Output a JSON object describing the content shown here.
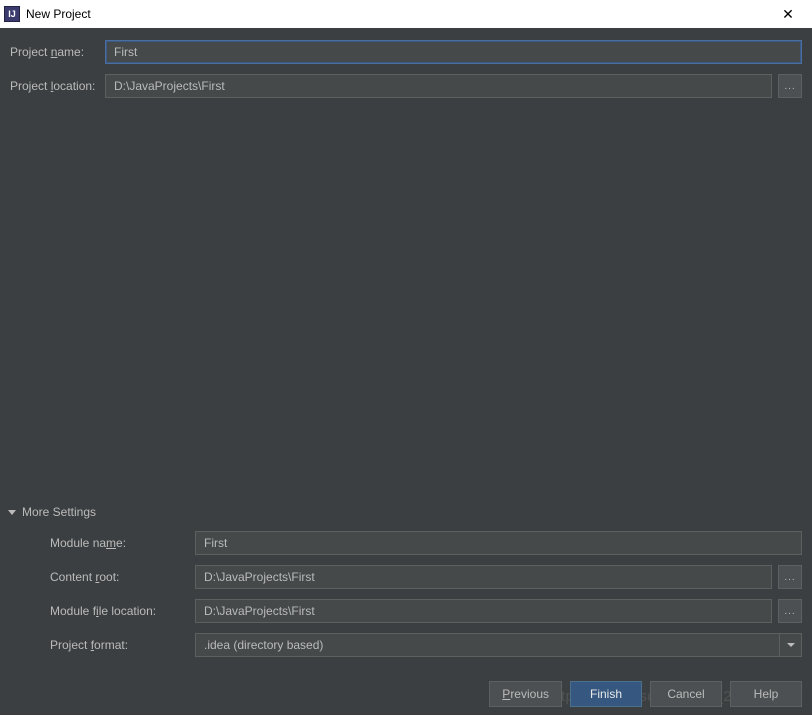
{
  "titlebar": {
    "title": "New Project"
  },
  "form": {
    "project_name_label": "Project name:",
    "project_name_value": "First",
    "project_location_label": "Project location:",
    "project_location_value": "D:\\JavaProjects\\First"
  },
  "more": {
    "header": "More Settings",
    "module_name_label": "Module name:",
    "module_name_value": "First",
    "content_root_label": "Content root:",
    "content_root_value": "D:\\JavaProjects\\First",
    "module_file_loc_label": "Module file location:",
    "module_file_loc_value": "D:\\JavaProjects\\First",
    "project_format_label": "Project format:",
    "project_format_value": ".idea (directory based)"
  },
  "buttons": {
    "previous": "Previous",
    "finish": "Finish",
    "cancel": "Cancel",
    "help": "Help"
  },
  "browse": "...",
  "watermark": "https://blog.csdn.net/qq_27359675"
}
